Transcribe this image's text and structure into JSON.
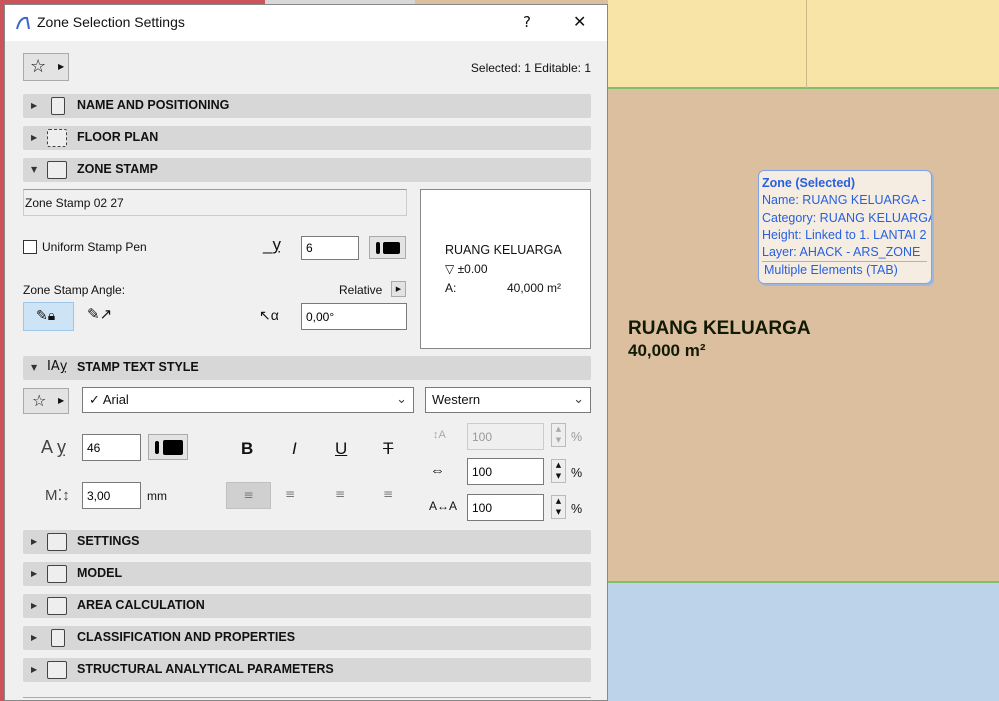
{
  "dialog": {
    "title": "Zone Selection Settings",
    "help": "?",
    "close": "✕",
    "status": "Selected: 1 Editable: 1"
  },
  "sections": {
    "name_positioning": "NAME AND POSITIONING",
    "floor_plan": "FLOOR PLAN",
    "zone_stamp": "ZONE STAMP",
    "stamp_text_style": "STAMP TEXT STYLE",
    "settings": "SETTINGS",
    "model": "MODEL",
    "area_calculation": "AREA CALCULATION",
    "classification": "CLASSIFICATION AND PROPERTIES",
    "structural": "STRUCTURAL ANALYTICAL PARAMETERS"
  },
  "zone_stamp": {
    "name": "Zone Stamp 02 27",
    "uniform_pen_label": "Uniform Stamp Pen",
    "uniform_pen_checked": false,
    "pen_value": "6",
    "angle_label": "Zone Stamp Angle:",
    "relative_label": "Relative",
    "angle_value": "0,00°",
    "preview": {
      "name": "RUANG KELUARGA",
      "level": "▽ ±0.00",
      "area_label": "A:",
      "area_value": "40,000 m²"
    }
  },
  "text_style": {
    "font": "Arial",
    "font_check": "✓",
    "script": "Western",
    "pen_value": "46",
    "size_value": "3,00",
    "size_unit": "mm",
    "bold": "B",
    "italic": "I",
    "underline": "U",
    "strike": "T",
    "line_spacing": "100",
    "width_factor": "100",
    "char_spacing": "100",
    "percent": "%"
  },
  "canvas": {
    "zone_name": "RUANG KELUARGA",
    "zone_area": "40,000 m²"
  },
  "tooltip": {
    "title": "Zone (Selected)",
    "lines": [
      "Name: RUANG KELUARGA -",
      "Category: RUANG KELUARGA",
      "Height: Linked to 1. LANTAI 2",
      "Layer:   AHACK - ARS_ZONE"
    ],
    "footer": "Multiple Elements (TAB)"
  },
  "colors": {
    "accent": "#2860e0",
    "selected_button": "#cde4f7"
  }
}
